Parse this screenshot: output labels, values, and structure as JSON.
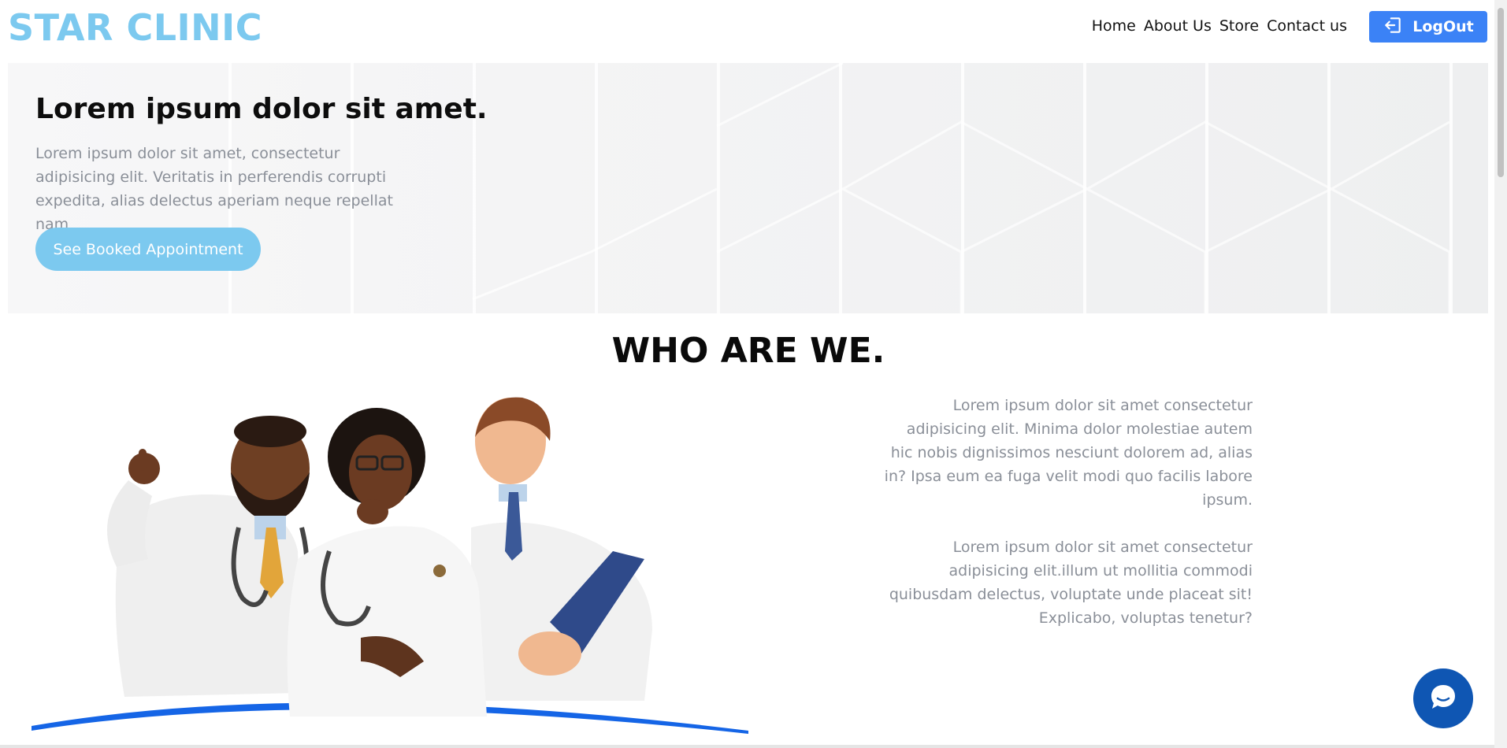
{
  "brand": "STAR CLINIC",
  "nav": {
    "links": [
      "Home",
      "About Us",
      "Store",
      "Contact us"
    ],
    "logout_label": "LogOut"
  },
  "hero": {
    "title": "Lorem ipsum dolor sit amet.",
    "text": "Lorem ipsum dolor sit amet, consectetur adipisicing elit. Veritatis in perferendis corrupti expedita, alias delectus aperiam neque repellat nam",
    "button_label": "See Booked Appointment"
  },
  "about": {
    "title": "WHO ARE WE.",
    "paragraph1": "Lorem ipsum dolor sit amet consectetur adipisicing elit. Minima dolor molestiae autem hic nobis dignissimos nesciunt dolorem ad, alias in? Ipsa eum ea fuga velit modi quo facilis labore ipsum.",
    "paragraph2": "Lorem ipsum dolor sit amet consectetur adipisicing elit.illum ut mollitia commodi quibusdam delectus, voluptate unde placeat sit! Explicabo, voluptas tenetur?"
  },
  "icons": {
    "logout": "logout-icon",
    "chat": "chat-icon",
    "illustration": "doctors-illustration"
  },
  "colors": {
    "brand": "#7cc9ef",
    "primary": "#3b82f6",
    "accent_wave": "#1565e6",
    "chat": "#0f56b3"
  }
}
